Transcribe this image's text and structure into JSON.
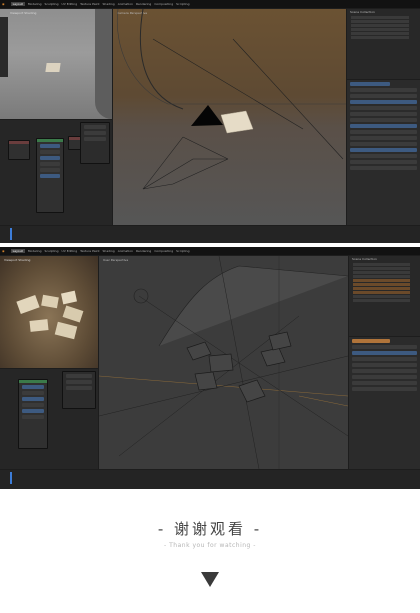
{
  "screenshot1": {
    "workspace_tabs": [
      "Layout",
      "Modeling",
      "Sculpting",
      "UV Editing",
      "Texture Paint",
      "Shading",
      "Animation",
      "Rendering",
      "Compositing",
      "Scripting"
    ],
    "active_tab": "Layout",
    "viewport_header": "Camera Perspective",
    "render_preview": "Viewport Shading",
    "outliner_title": "Scene Collection"
  },
  "screenshot2": {
    "workspace_tabs": [
      "Layout",
      "Modeling",
      "Sculpting",
      "UV Editing",
      "Texture Paint",
      "Shading",
      "Animation",
      "Rendering",
      "Compositing",
      "Scripting"
    ],
    "active_tab": "Layout",
    "viewport_header": "User Perspective",
    "render_preview": "Viewport Shading",
    "outliner_title": "Scene Collection"
  },
  "footer": {
    "title": "- 谢谢观看 -",
    "subtitle": "- Thank you for watching -"
  },
  "icons": {
    "down_arrow": "down-triangle-icon"
  },
  "colors": {
    "accent_orange": "#e08a2e",
    "accent_blue": "#3d5a80",
    "viewport_brown": "#5a4530",
    "viewport_grey": "#4a4a4a"
  }
}
